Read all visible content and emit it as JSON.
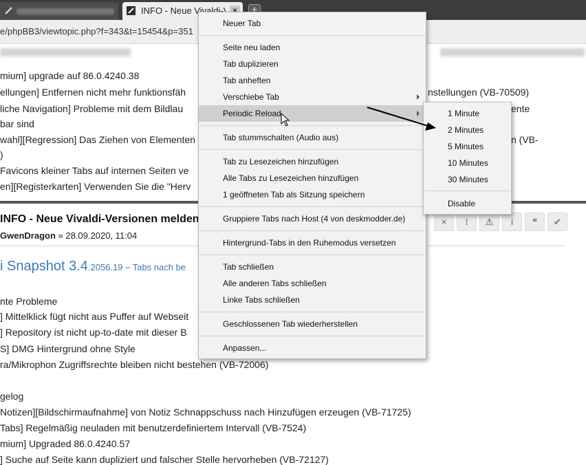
{
  "browser": {
    "active_tab_title": "INFO - Neue Vivaldi-V",
    "close_glyph": "×",
    "new_tab_glyph": "+",
    "url_prefix": "e/phpBB3/viewtopic.php?f=343&t=15454&p=351"
  },
  "page": {
    "lines_top": [
      "mium] upgrade auf 86.0.4240.38",
      "ellungen] Entfernen nicht mehr funktionsfäh",
      "liche Navigation] Probleme mit dem Bildlau",
      "bar sind",
      "wahl][Regression] Das Ziehen von Elementen",
      ")",
      " Favicons kleiner Tabs auf internen Seiten ve",
      "en][Registerkarten] Verwenden Sie die \"Herv"
    ],
    "lines_right": [
      "nstellungen (VB-70509)",
      "ente",
      "n (VB-"
    ],
    "post_title": "INFO - Neue Vivaldi-Versionen melden",
    "post_author": "GwenDragon",
    "post_date": " » 28.09.2020, 11:04",
    "snapshot_big": "i Snapshot 3.4",
    "snapshot_small": ".2056.19 – Tabs nach be",
    "lines_bottom": [
      "nte Probleme",
      "] Mittelklick fügt nicht aus Puffer auf Webseit",
      "] Repository ist nicht up-to-date mit dieser B",
      "S] DMG Hintergrund ohne Style",
      "ra/Mikrophon Zugriffsrechte bleiben nicht bestehen (VB-72006)",
      "",
      "gelog",
      "Notizen][Bildschirmaufnahme] von Notiz Schnappschuss nach Hinzufügen erzeugen (VB-71725)",
      "Tabs] Regelmäßig neuladen mit benutzerdefiniertem Intervall (VB-7524)",
      "mium] Upgraded 86.0.4240.57",
      "] Suche auf Seite kann dupliziert und falscher Stelle hervorheben (VB-72127)"
    ],
    "post_buttons": [
      "×",
      "!",
      "⚠",
      "i",
      "❝",
      "✔"
    ]
  },
  "context_menu": {
    "items": [
      "Neuer Tab",
      "Seite neu laden",
      "Tab duplizieren",
      "Tab anheften",
      "Verschiebe Tab",
      "Periodic Reload",
      "Tab stummschalten (Audio aus)",
      "Tab zu Lesezeichen hinzufügen",
      "Alle Tabs zu Lesezeichen hinzufügen",
      "1 geöffneten Tab als Sitzung speichern",
      "Gruppiere Tabs nach Host (4 von deskmodder.de)",
      "Hintergrund-Tabs in den Ruhemodus versetzen",
      "Tab schließen",
      "Alle anderen Tabs schließen",
      "Linke Tabs schließen",
      "Geschlossenen Tab wiederherstellen",
      "Anpassen..."
    ],
    "highlighted": "Periodic Reload"
  },
  "submenu": {
    "items": [
      "1 Minute",
      "2 Minutes",
      "5 Minutes",
      "10 Minutes",
      "30 Minutes",
      "Disable"
    ]
  },
  "colors": {
    "tab_strip": "#3c3c3c",
    "menu_bg": "#f2f2f2",
    "menu_highlight": "#cfcfcf",
    "link_blue": "#3d7ab8"
  }
}
